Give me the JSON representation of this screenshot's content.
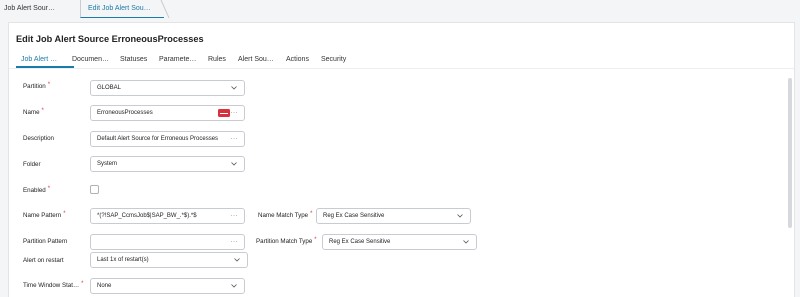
{
  "doc_tabs": [
    {
      "label": "Job Alert Sour…"
    },
    {
      "label": "Edit Job Alert Sou…"
    }
  ],
  "page_title": "Edit Job Alert Source ErroneousProcesses",
  "sub_tabs": [
    {
      "label": "Job Alert …"
    },
    {
      "label": "Documen…"
    },
    {
      "label": "Statuses"
    },
    {
      "label": "Paramete…"
    },
    {
      "label": "Rules"
    },
    {
      "label": "Alert Sou…"
    },
    {
      "label": "Actions"
    },
    {
      "label": "Security"
    }
  ],
  "form": {
    "partition": {
      "label": "Partition",
      "value": "GLOBAL"
    },
    "name": {
      "label": "Name",
      "value": "ErroneousProcesses"
    },
    "description": {
      "label": "Description",
      "value": "Default Alert Source for Erroneous Processes"
    },
    "folder": {
      "label": "Folder",
      "value": "System"
    },
    "enabled": {
      "label": "Enabled"
    },
    "name_pattern": {
      "label": "Name Pattern",
      "value": "*(?!SAP_CcmsJob$|SAP_BW_.*$).*$"
    },
    "name_match_type": {
      "label": "Name Match Type",
      "value": "Reg Ex Case Sensitive"
    },
    "partition_pattern": {
      "label": "Partition Pattern",
      "value": ""
    },
    "partition_match_type": {
      "label": "Partition Match Type",
      "value": "Reg Ex Case Sensitive"
    },
    "alert_on_restart": {
      "label": "Alert on restart",
      "value": "Last 1x of restart(s)"
    },
    "time_window_status": {
      "label": "Time Window Stat…",
      "value": "None"
    }
  },
  "colors": {
    "accent": "#1a7aa8",
    "required": "#d9303e"
  },
  "icons": {
    "dropdown": "chevron-down-icon",
    "more": "ellipsis-icon",
    "badge": "red-badge-icon"
  }
}
